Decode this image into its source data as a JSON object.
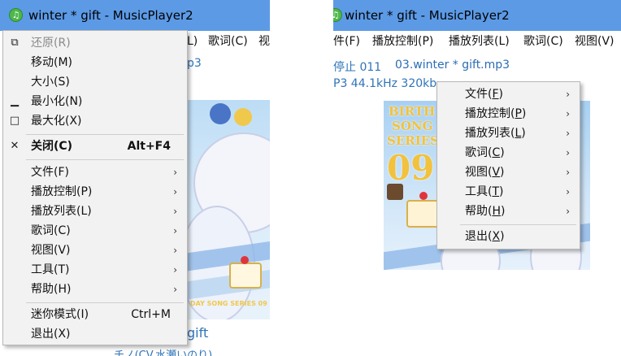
{
  "left_window": {
    "title": "winter * gift - MusicPlayer2",
    "app_icon": "music-note-icon",
    "menubar_visible": [
      "L)",
      "歌词(C)",
      "视"
    ],
    "info_fragment": "p3",
    "bottom_title": "gift",
    "bottom_artist": "チノ(CV.水瀬いのり)",
    "art_caption": "DAY SONG SERIES 09",
    "system_menu": {
      "items": [
        {
          "icon": "restore-icon",
          "label": "还原(R)",
          "disabled": true
        },
        {
          "label": "移动(M)"
        },
        {
          "label": "大小(S)"
        },
        {
          "icon": "minimize-icon",
          "label": "最小化(N)"
        },
        {
          "icon": "maximize-icon",
          "label": "最大化(X)"
        },
        {
          "icon": "close-icon",
          "label": "关闭(C)",
          "shortcut": "Alt+F4",
          "bold": true
        }
      ],
      "app_items": [
        {
          "label": "文件(F)",
          "submenu": true
        },
        {
          "label": "播放控制(P)",
          "submenu": true
        },
        {
          "label": "播放列表(L)",
          "submenu": true
        },
        {
          "label": "歌词(C)",
          "submenu": true
        },
        {
          "label": "视图(V)",
          "submenu": true
        },
        {
          "label": "工具(T)",
          "submenu": true
        },
        {
          "label": "帮助(H)",
          "submenu": true
        }
      ],
      "extra_items": [
        {
          "label": "迷你模式(I)",
          "shortcut": "Ctrl+M"
        },
        {
          "label": "退出(X)"
        }
      ]
    }
  },
  "right_window": {
    "title": "winter * gift - MusicPlayer2",
    "app_icon": "music-note-icon",
    "menubar": [
      "件(F)",
      "播放控制(P)",
      "播放列表(L)",
      "歌词(C)",
      "视图(V)"
    ],
    "status": "停止 011",
    "filename": "03.winter * gift.mp3",
    "format_info": "P3 44.1kHz 320kb",
    "art_text": [
      "BIRTH",
      "SONG",
      "SERIES",
      "09"
    ],
    "context_menu": {
      "items": [
        {
          "label": "文件",
          "key": "F",
          "submenu": true
        },
        {
          "label": "播放控制",
          "key": "P",
          "submenu": true
        },
        {
          "label": "播放列表",
          "key": "L",
          "submenu": true
        },
        {
          "label": "歌词",
          "key": "C",
          "submenu": true
        },
        {
          "label": "视图",
          "key": "V",
          "submenu": true
        },
        {
          "label": "工具",
          "key": "T",
          "submenu": true
        },
        {
          "label": "帮助",
          "key": "H",
          "submenu": true
        }
      ],
      "exit": {
        "label": "退出",
        "key": "X"
      }
    }
  }
}
